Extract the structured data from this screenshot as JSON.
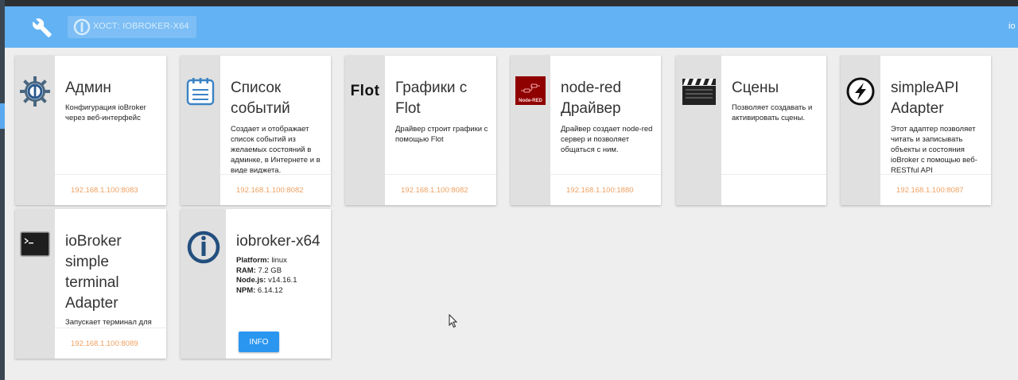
{
  "header": {
    "host_label": "ХОСТ: IOBROKER-X64",
    "right_text": "io"
  },
  "cards": [
    {
      "title": "Админ",
      "desc": "Конфигурация ioBroker через веб-интерфейс",
      "link": "192.168.1.100:8083",
      "icon": "iobroker-admin-icon"
    },
    {
      "title": "Список событий",
      "desc": "Создает и отображает список событий из желаемых состояний в админке, в Интернете и в виде виджета.",
      "link": "192.168.1.100:8082",
      "icon": "notepad-icon"
    },
    {
      "title": "Графики с Flot",
      "desc": "Драйвер строит графики с помощью Flot",
      "link": "192.168.1.100:8082",
      "icon": "flot-logo",
      "icon_text": "Flot"
    },
    {
      "title": "node-red Драйвер",
      "desc": "Драйвер создает node-red сервер и позволяет общаться с ним.",
      "link": "192.168.1.100:1880",
      "icon": "node-red-icon",
      "icon_text": "Node-RED"
    },
    {
      "title": "Сцены",
      "desc": "Позволяет создавать и активировать сцены.",
      "link": "",
      "icon": "clapperboard-icon"
    },
    {
      "title": "simpleAPI Adapter",
      "desc": "Этот адаптер позволяет читать и записывать объекты и состояния ioBroker с помощью веб-RESTful API",
      "link": "192.168.1.100:8087",
      "icon": "lightning-icon"
    },
    {
      "title": "ioBroker simple terminal Adapter",
      "desc": "Запускает терминал для",
      "link": "192.168.1.100:8089",
      "icon": "terminal-icon"
    }
  ],
  "host_card": {
    "title": "iobroker-x64",
    "platform_label": "Platform:",
    "platform_value": "linux",
    "ram_label": "RAM:",
    "ram_value": "7.2 GB",
    "node_label": "Node.js:",
    "node_value": "v14.16.1",
    "npm_label": "NPM:",
    "npm_value": "6.14.12",
    "button_label": "INFO"
  },
  "colors": {
    "header": "#63b2f3",
    "link": "#f0a060",
    "button": "#2b96f0",
    "side": "#e0e0e0"
  }
}
